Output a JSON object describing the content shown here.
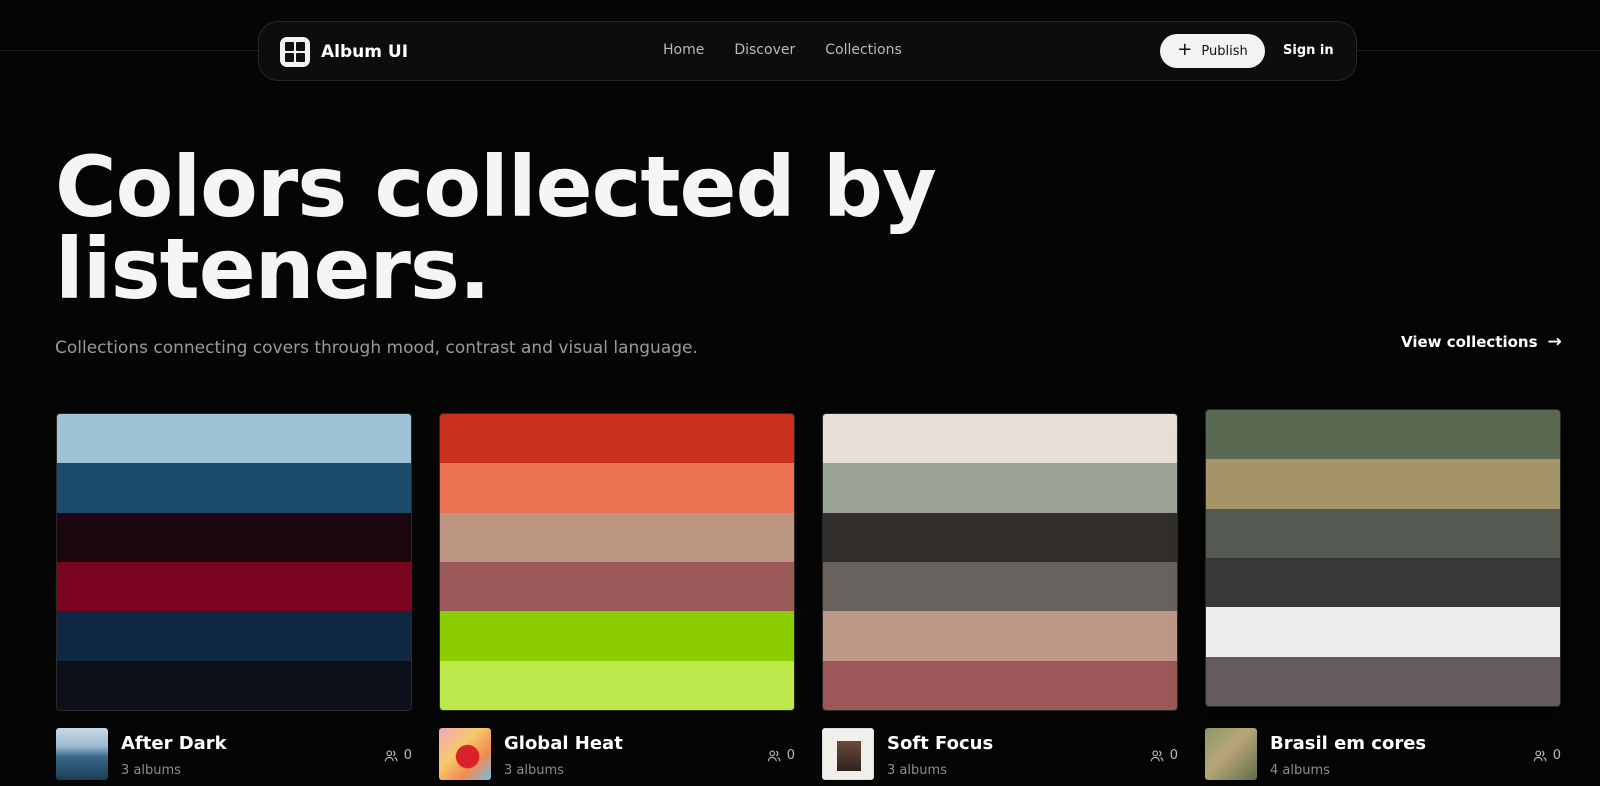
{
  "nav": {
    "logo_text": "Album UI",
    "links": [
      "Home",
      "Discover",
      "Collections"
    ],
    "publish_label": "Publish",
    "signin_label": "Sign in"
  },
  "hero": {
    "title": "Colors collected by listeners.",
    "subtitle": "Collections connecting covers through mood, contrast and visual language.",
    "view_collections_label": "View collections"
  },
  "cards": [
    {
      "title": "After Dark",
      "count": "3 albums",
      "followers": "0",
      "colors": [
        "#9ec3d6",
        "#1c4c6b",
        "#1a0710",
        "#7b0420",
        "#0f2740",
        "#0c1119"
      ],
      "thumb_icon": "ocean-cover-thumbnail"
    },
    {
      "title": "Global Heat",
      "count": "3 albums",
      "followers": "0",
      "colors": [
        "#c9311c",
        "#eb7351",
        "#bd9681",
        "#9c595a",
        "#8ccd00",
        "#bde84b"
      ],
      "thumb_icon": "cartoon-heart-cover-thumbnail"
    },
    {
      "title": "Soft Focus",
      "count": "3 albums",
      "followers": "0",
      "colors": [
        "#e6e0d6",
        "#9ba398",
        "#322e2b",
        "#68625e",
        "#bd9886",
        "#9c5859"
      ],
      "thumb_icon": "blond-cover-thumbnail"
    },
    {
      "title": "Brasil em cores",
      "count": "4 albums",
      "followers": "0",
      "colors": [
        "#5a6a52",
        "#a69469",
        "#545a52",
        "#363839",
        "#f0eeed",
        "#645c5c"
      ],
      "thumb_icon": "garden-cover-thumbnail"
    }
  ]
}
